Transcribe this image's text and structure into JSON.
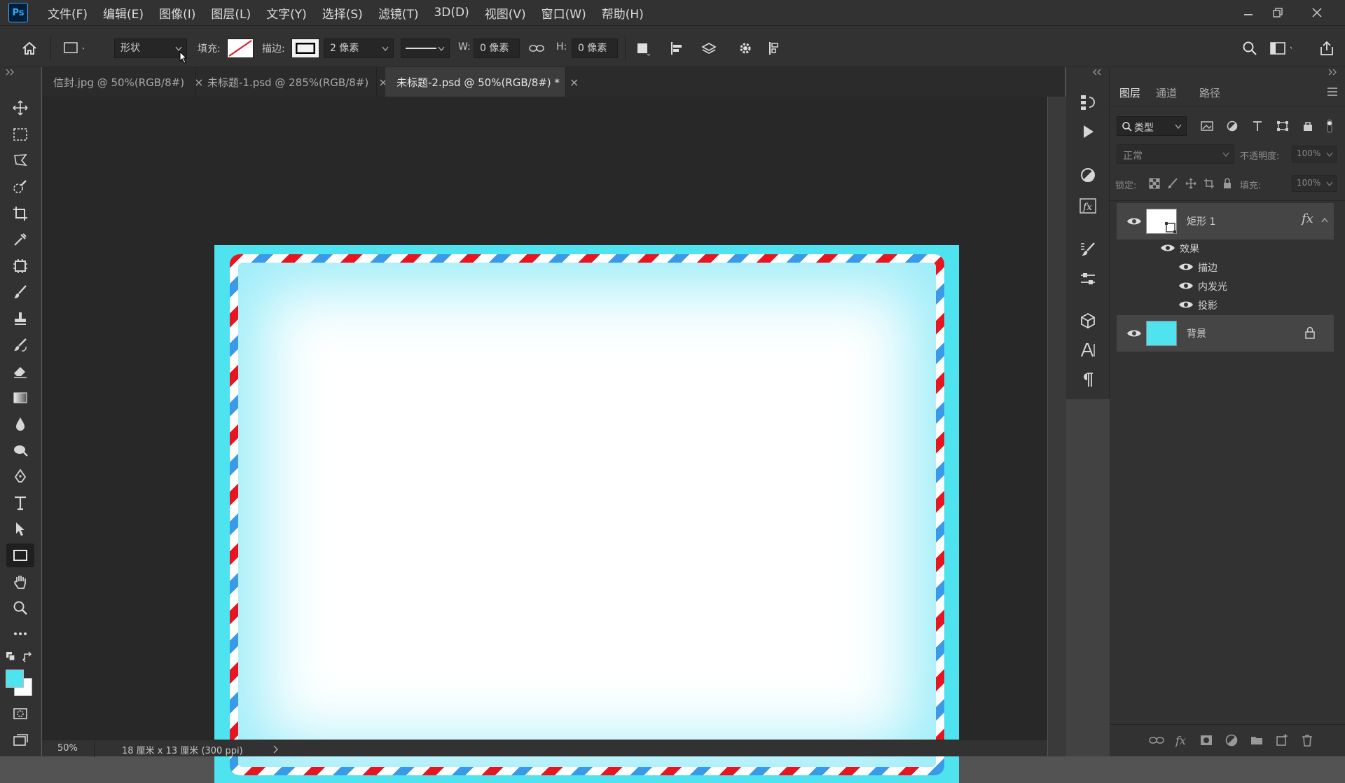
{
  "app": {
    "logo": "Ps",
    "menu": [
      "文件(F)",
      "编辑(E)",
      "图像(I)",
      "图层(L)",
      "文字(Y)",
      "选择(S)",
      "滤镜(T)",
      "3D(D)",
      "视图(V)",
      "窗口(W)",
      "帮助(H)"
    ]
  },
  "options": {
    "mode": "形状",
    "fill_label": "填充:",
    "stroke_label": "描边:",
    "stroke_width": "2 像素",
    "w_label": "W:",
    "w_value": "0 像素",
    "h_label": "H:",
    "h_value": "0 像素"
  },
  "tabs": [
    {
      "label": "信封.jpg @ 50%(RGB/8#)",
      "active": false
    },
    {
      "label": "未标题-1.psd @ 285%(RGB/8#)",
      "active": false
    },
    {
      "label": "未标题-2.psd @ 50%(RGB/8#) *",
      "active": true
    }
  ],
  "status": {
    "zoom": "50%",
    "doc_info": "18 厘米 x 13 厘米 (300 ppi)"
  },
  "layers_panel": {
    "tabs": [
      "图层",
      "通道",
      "路径"
    ],
    "filter_label": "类型",
    "blend_mode": "正常",
    "opacity_label": "不透明度:",
    "opacity_value": "100%",
    "lock_label": "锁定:",
    "fill_label": "填充:",
    "fill_value": "100%",
    "layers": [
      {
        "name": "矩形 1",
        "fx": "fx",
        "effects_label": "效果",
        "effects": [
          "描边",
          "内发光",
          "投影"
        ]
      },
      {
        "name": "背景"
      }
    ]
  },
  "colors": {
    "foreground": "#4fe2ef",
    "background": "#ffffff",
    "artboard": "#4fe2ef",
    "stripe_red": "#e8141f",
    "stripe_blue": "#3a9ae8"
  }
}
